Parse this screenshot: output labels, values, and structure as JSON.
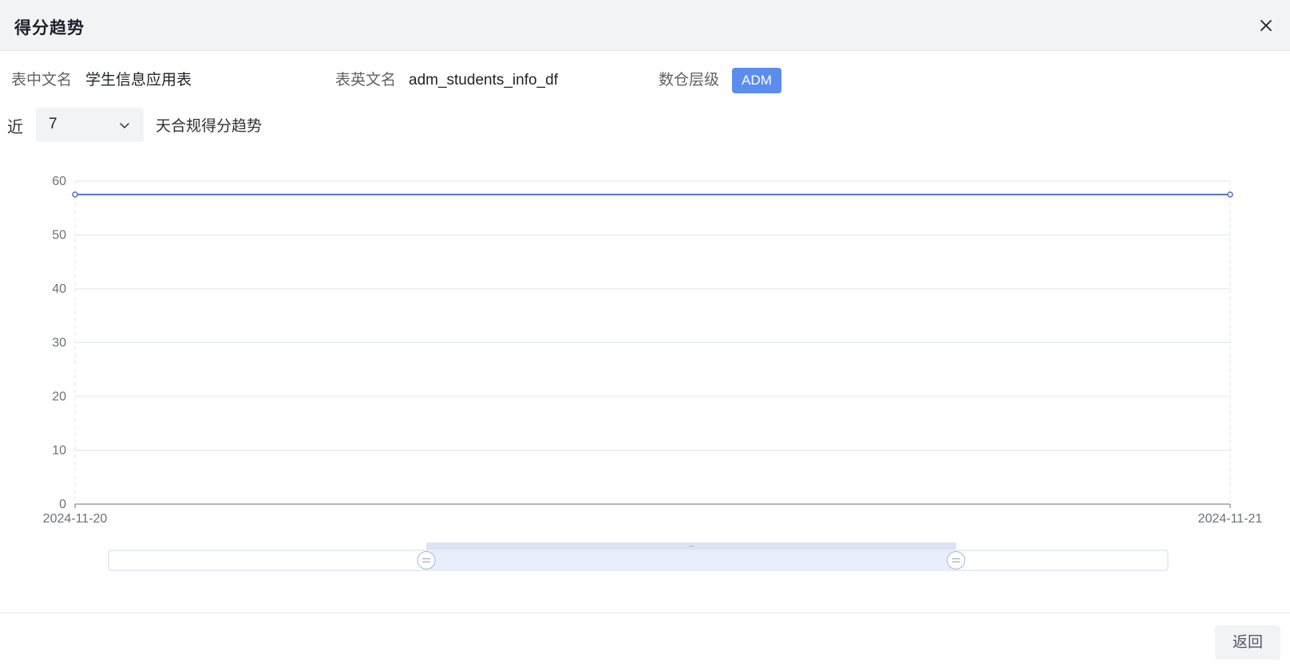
{
  "dialog": {
    "title": "得分趋势",
    "close_icon": "close-icon"
  },
  "table_info": {
    "cn_name_label": "表中文名",
    "cn_name_value": "学生信息应用表",
    "en_name_label": "表英文名",
    "en_name_value": "adm_students_info_df",
    "layer_label": "数仓层级",
    "layer_value": "ADM",
    "layer_color": "#5b8def"
  },
  "period": {
    "prefix": "近",
    "selected": "7",
    "suffix": "天合规得分趋势",
    "chevron_icon": "chevron-down-icon"
  },
  "chart_data": {
    "type": "line",
    "x": [
      "2024-11-20",
      "2024-11-21"
    ],
    "series": [
      {
        "values": [
          57.5,
          57.5
        ],
        "color": "#5470c6"
      }
    ],
    "y_ticks": [
      0,
      10,
      20,
      30,
      40,
      50,
      60
    ],
    "ylim": [
      0,
      60
    ],
    "grid": true,
    "datazoom": {
      "start_percent": 30,
      "end_percent": 80
    }
  },
  "footer": {
    "back_label": "返回"
  }
}
